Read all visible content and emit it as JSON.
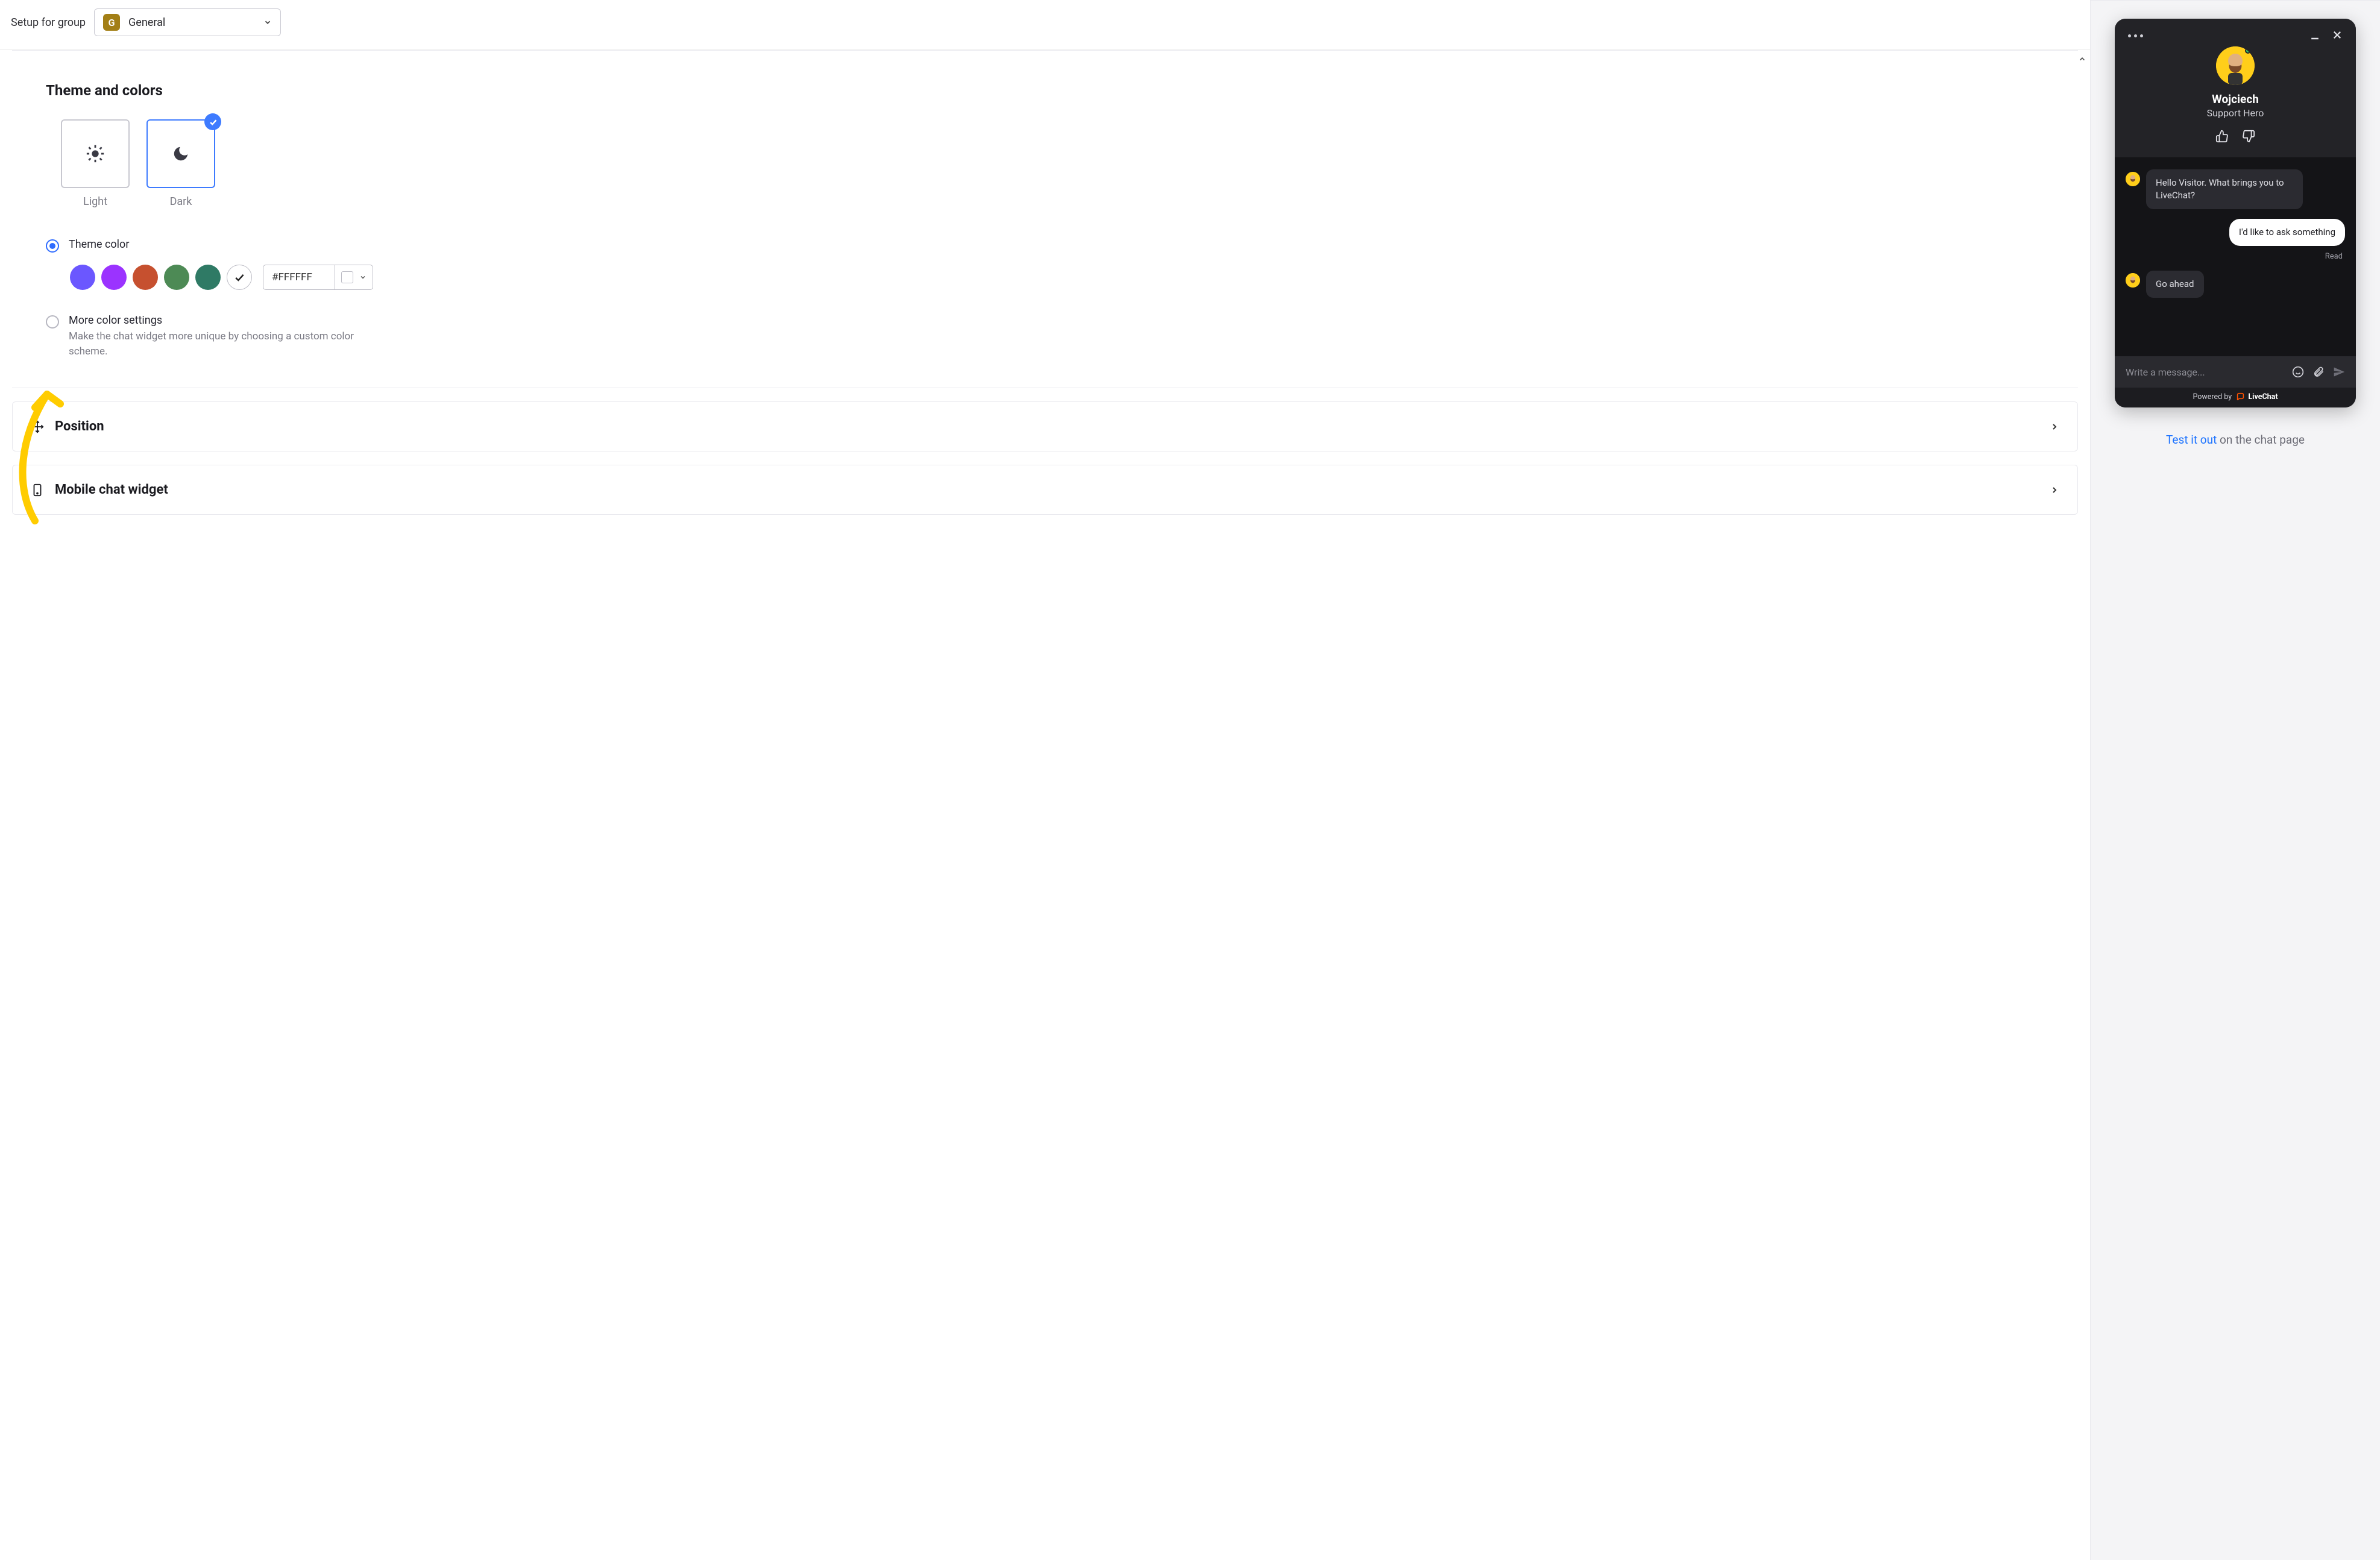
{
  "topbar": {
    "label": "Setup for group",
    "group_badge": "G",
    "group_name": "General"
  },
  "theme_panel": {
    "title": "Theme and colors",
    "light_label": "Light",
    "dark_label": "Dark",
    "selected": "dark",
    "color_option": {
      "label": "Theme color",
      "selected": true,
      "swatches": [
        "#6b57ff",
        "#9b33ff",
        "#c6502f",
        "#4d8a55",
        "#2f7a65"
      ],
      "custom_selected": true,
      "hex": "#FFFFFF"
    },
    "more_option": {
      "label": "More color settings",
      "selected": false,
      "desc": "Make the chat widget more unique by choosing a custom color scheme."
    }
  },
  "sections": {
    "position": "Position",
    "mobile": "Mobile chat widget"
  },
  "chat": {
    "agent_name": "Wojciech",
    "agent_role": "Support Hero",
    "msg_agent1": "Hello Visitor. What brings you to LiveChat?",
    "msg_user1": "I'd like to ask something",
    "read": "Read",
    "msg_agent2": "Go ahead",
    "placeholder": "Write a message...",
    "powered": "Powered by",
    "brand": "LiveChat"
  },
  "footer": {
    "test_link": "Test it out",
    "test_rest": " on the chat page"
  }
}
